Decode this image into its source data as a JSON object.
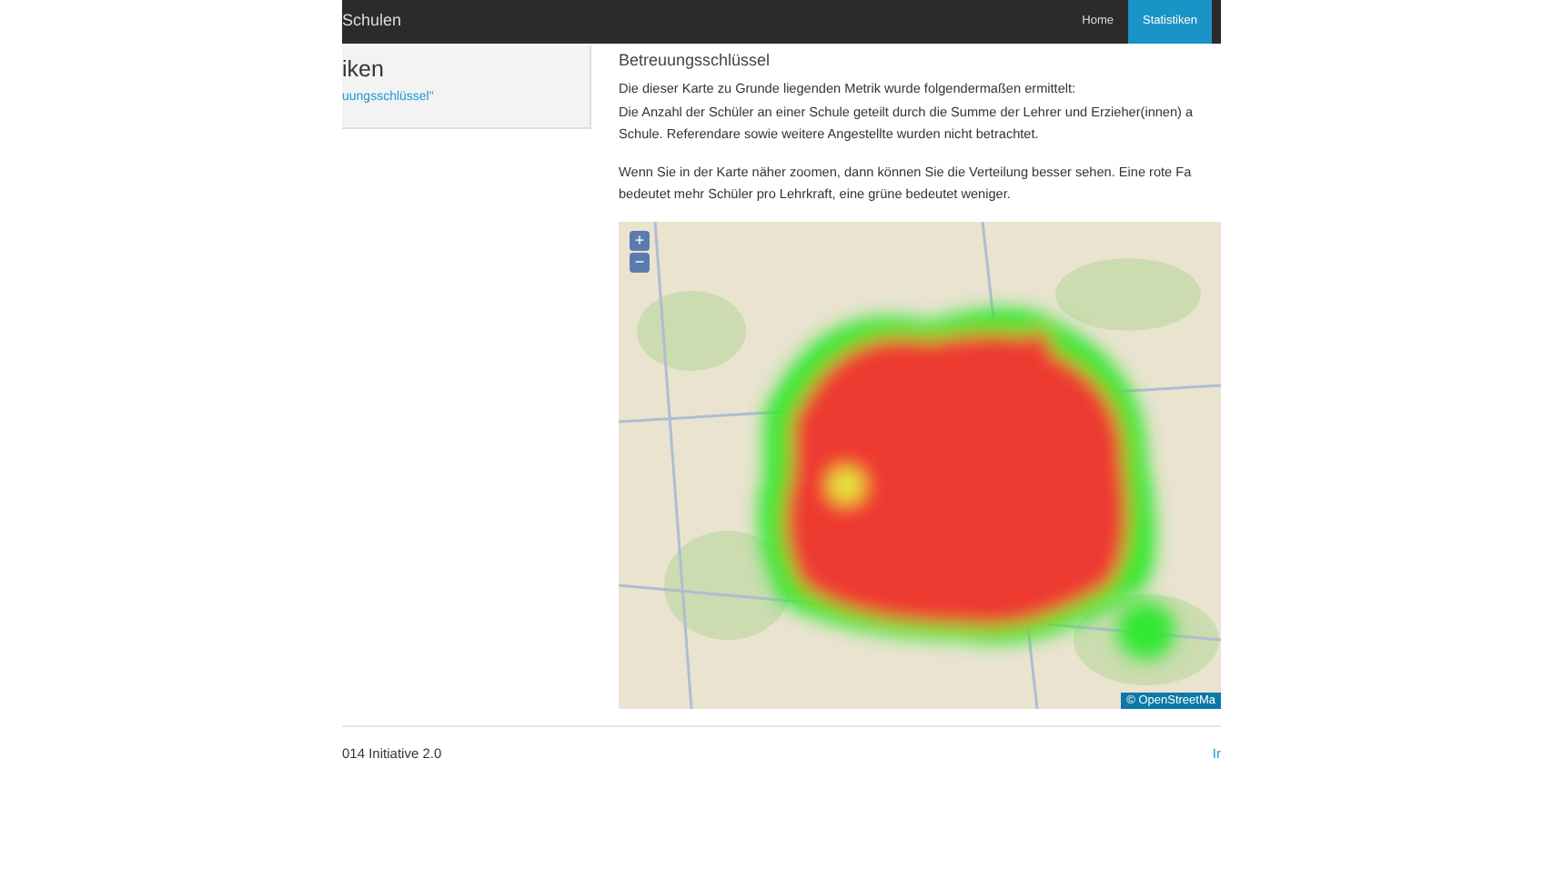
{
  "navbar": {
    "brand": "Schulen",
    "items": [
      {
        "label": "Home",
        "selected": false
      },
      {
        "label": "Statistiken",
        "selected": true
      }
    ]
  },
  "sidebar": {
    "title": "iken",
    "link": "uungsschlüssel\""
  },
  "main": {
    "heading": "Betreuungsschlüssel",
    "paragraphs": [
      [
        "Die dieser Karte zu Grunde liegenden Metrik wurde folgendermaßen ermittelt:",
        "Die Anzahl der Schüler an einer Schule geteilt durch die Summe der Lehrer und Erzieher(innen) a",
        "Schule. Referendare sowie weitere Angestellte wurden nicht betrachtet."
      ],
      [
        "Wenn Sie in der Karte näher zoomen, dann können Sie die Verteilung besser sehen. Eine rote Fa",
        "bedeutet mehr Schüler pro Lehrkraft, eine grüne bedeutet weniger."
      ]
    ],
    "map": {
      "zoom_in": "+",
      "zoom_out": "−",
      "attribution": "© OpenStreetMa"
    }
  },
  "footer": {
    "text": "014 Initiative 2.0",
    "link": "Ir"
  }
}
